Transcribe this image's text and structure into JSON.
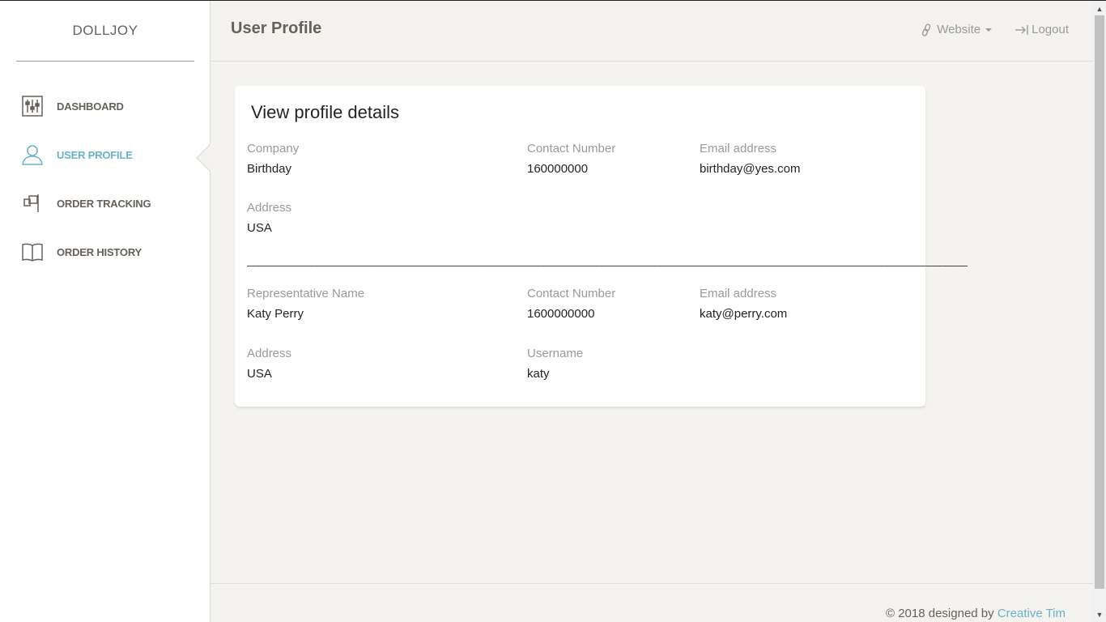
{
  "brand": "DOLLJOY",
  "sidebar": {
    "items": [
      {
        "label": "DASHBOARD"
      },
      {
        "label": "USER PROFILE"
      },
      {
        "label": "ORDER TRACKING"
      },
      {
        "label": "ORDER HISTORY"
      }
    ],
    "active_index": 1
  },
  "header": {
    "title": "User Profile",
    "website_label": "Website",
    "logout_label": "Logout"
  },
  "card": {
    "title": "View profile details",
    "company": {
      "company_label": "Company",
      "company_value": "Birthday",
      "contact_label": "Contact Number",
      "contact_value": "160000000",
      "email_label": "Email address",
      "email_value": "birthday@yes.com",
      "address_label": "Address",
      "address_value": "USA"
    },
    "separator": "________________________________________________________________________________________________________________________________________________",
    "representative": {
      "name_label": "Representative Name",
      "name_value": "Katy Perry",
      "contact_label": "Contact Number",
      "contact_value": "1600000000",
      "email_label": "Email address",
      "email_value": "katy@perry.com",
      "address_label": "Address",
      "address_value": "USA",
      "username_label": "Username",
      "username_value": "katy"
    }
  },
  "footer": {
    "prefix": "© 2018 designed by ",
    "link": "Creative Tim"
  },
  "colors": {
    "accent": "#68b3c8",
    "muted": "#9a9a9a",
    "background": "#f4f3ef"
  }
}
